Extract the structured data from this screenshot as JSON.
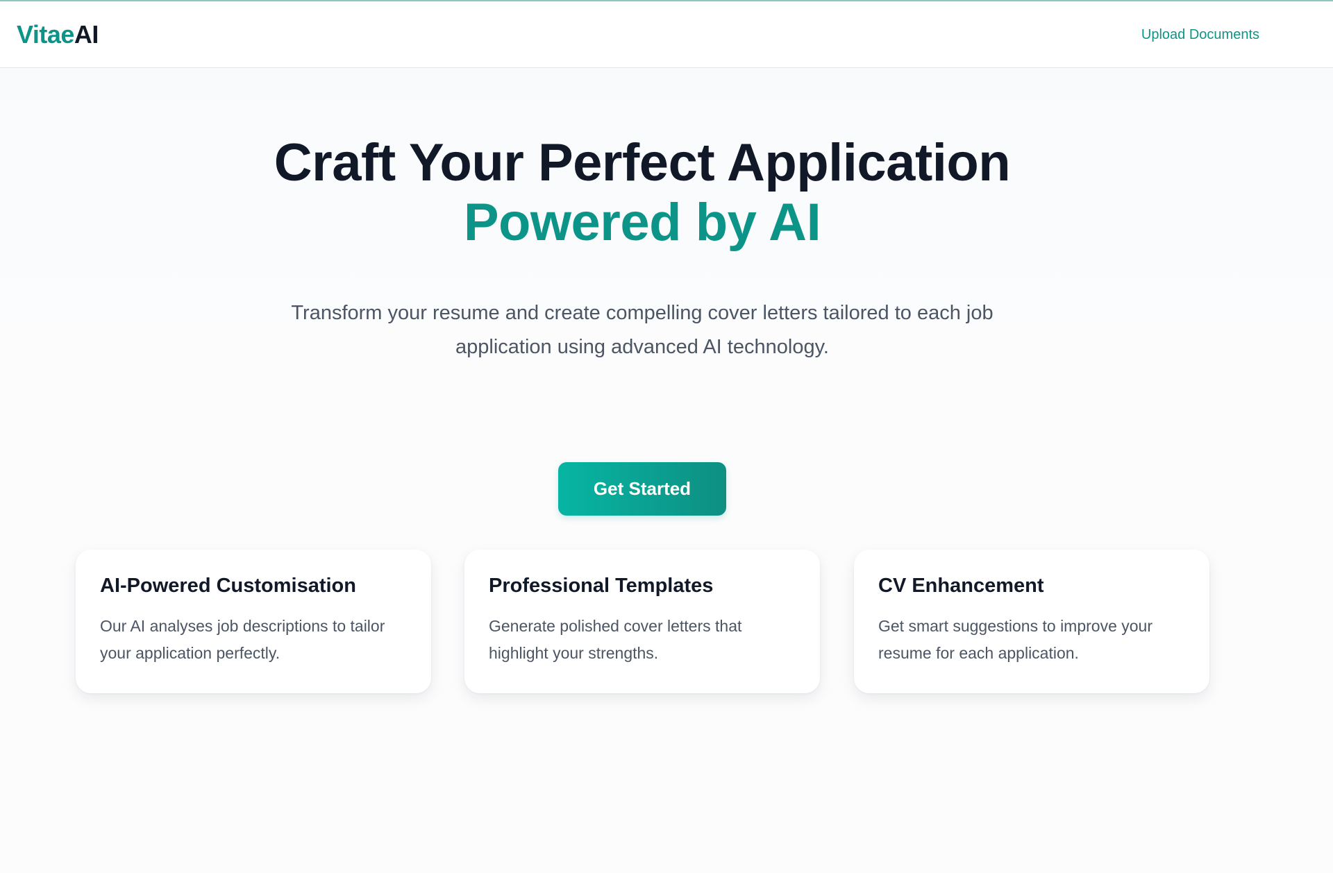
{
  "header": {
    "logo_part1": "Vitae",
    "logo_part2": "AI",
    "upload_link": "Upload Documents"
  },
  "hero": {
    "title_line1": "Craft Your Perfect Application",
    "title_line2": "Powered by AI",
    "subtitle": "Transform your resume and create compelling cover letters tailored to each job application using advanced AI technology.",
    "cta_label": "Get Started"
  },
  "features": [
    {
      "title": "AI-Powered Customisation",
      "description": "Our AI analyses job descriptions to tailor your application perfectly."
    },
    {
      "title": "Professional Templates",
      "description": "Generate polished cover letters that highlight your strengths."
    },
    {
      "title": "CV Enhancement",
      "description": "Get smart suggestions to improve your resume for each application."
    }
  ],
  "colors": {
    "accent": "#0d9488",
    "text_dark": "#111827",
    "text_muted": "#4b5563"
  }
}
